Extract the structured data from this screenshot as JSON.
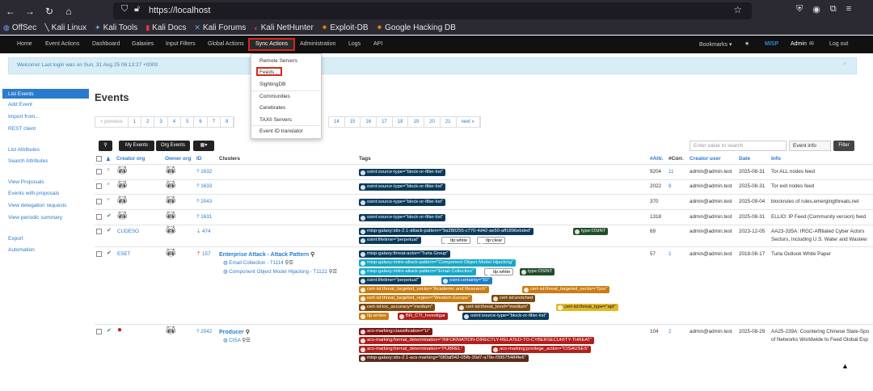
{
  "browser": {
    "url": "https://localhost",
    "bookmarks": [
      "OffSec",
      "Kali Linux",
      "Kali Tools",
      "Kali Docs",
      "Kali Forums",
      "Kali NetHunter",
      "Exploit-DB",
      "Google Hacking DB"
    ]
  },
  "topnav": {
    "items": [
      "Home",
      "Event Actions",
      "Dashboard",
      "Galaxies",
      "Input Filters",
      "Global Actions",
      "Sync Actions",
      "Administration",
      "Logs",
      "API"
    ],
    "right": [
      "Bookmarks ▾",
      "MISP",
      "Admin",
      "Log out"
    ]
  },
  "welcome": "Welcome! Last login was on Sun, 31 Aug 25 06:13:27 +0000",
  "sync_menu": [
    "Remote Servers",
    "Feeds",
    "SightingDB",
    "Communities",
    "Cerebrates",
    "TAXII Servers",
    "Event ID translator"
  ],
  "sidebar": {
    "group1": [
      "List Events",
      "Add Event",
      "Import from...",
      "REST client"
    ],
    "group2": [
      "List Attributes",
      "Search Attributes"
    ],
    "group3": [
      "View Proposals",
      "Events with proposals",
      "View delegation requests",
      "View periodic summary"
    ],
    "group4": [
      "Export",
      "Automation"
    ]
  },
  "page_title": "Events",
  "pagination": {
    "prev": "« previous",
    "pages_a": [
      "1",
      "2",
      "3",
      "4",
      "5",
      "6",
      "7",
      "8"
    ],
    "pages_b": [
      "14",
      "15",
      "16",
      "17",
      "18",
      "19",
      "20",
      "21"
    ],
    "next": "next »"
  },
  "toolbar": {
    "my_events": "My Events",
    "org_events": "Org Events",
    "search_placeholder": "Enter value to search",
    "filter_select": "Event info",
    "filter_button": "Filter"
  },
  "columns": [
    "Creator org",
    "Owner org",
    "ID",
    "Clusters",
    "Tags",
    "#Attr.",
    "#Corr.",
    "Creator user",
    "Date",
    "Info"
  ],
  "rows": [
    {
      "status": "×",
      "creator": "",
      "id": "1632",
      "attr": "9204",
      "corr": "11",
      "user": "admin@admin.test",
      "date": "2025-08-31",
      "info": "Tor ALL nodes feed",
      "tags": [
        "osint:source-type=\"block-or-filter-list\""
      ]
    },
    {
      "status": "×",
      "creator": "",
      "id": "1633",
      "attr": "2022",
      "corr": "8",
      "user": "admin@admin.test",
      "date": "2025-08-31",
      "info": "Tor exit nodes feed",
      "tags": [
        "osint:source-type=\"block-or-filter-list\""
      ]
    },
    {
      "status": "×",
      "creator": "",
      "id": "2043",
      "attr": "370",
      "corr": "",
      "user": "admin@admin.test",
      "date": "2025-09-04",
      "info": "blockrules of rules.emergingthreats.net",
      "tags": [
        "osint:source-type=\"block-or-filter-list\""
      ]
    },
    {
      "status": "✔",
      "creator": "",
      "id": "1631",
      "attr": "1318",
      "corr": "",
      "user": "admin@admin.test",
      "date": "2025-08-31",
      "info": "ELLIO: IP Feed (Community version) feed",
      "tags": [
        "osint:source-type=\"block-or-filter-list\""
      ]
    },
    {
      "status": "✔",
      "creator": "CUDESO",
      "id": "474",
      "attr": "69",
      "corr": "",
      "user": "admin@admin.test",
      "date": "2023-12-05",
      "info": "AA23-335A: IRGC-Affiliated Cyber Actors",
      "info2": "Sectors, Including U.S. Water and Wastew",
      "tags": [
        "misp-galaxy:stix-2.1-attack-pattern=\"9a280255-c770-4d42-ae50-aff1896ebded\"",
        "type:OSINT",
        "osint:lifetime=\"perpetual\"",
        "tlp:white",
        "tlp:clear"
      ]
    },
    {
      "status": "✔",
      "creator": "ESET",
      "id": "157",
      "attr": "57",
      "corr": "1",
      "user": "admin@admin.test",
      "date": "2018-08-17",
      "info": "Turla Outlook White Paper",
      "clusters": {
        "title": "Enterprise Attack - Attack Pattern",
        "items": [
          "Email Collection - T1114",
          "Component Object Model Hijacking - T1122"
        ]
      },
      "tags": [
        "misp-galaxy:threat-actor=\"Turla Group\"",
        "misp-galaxy:mitre-attack-pattern=\"Component Object Model Hijacking\"",
        "misp-galaxy:mitre-attack-pattern=\"Email Collection\"",
        "tlp:white",
        "type:OSINT",
        "osint:lifetime=\"perpetual\"",
        "osint:certainty=\"50\"",
        "cert-ist:threat_targeted_sector=\"Academic and Research\"",
        "cert-ist:threat_targeted_sector=\"Gov\"",
        "cert-ist:threat_targeted_region=\"Western Europe\"",
        "cert-ist:enriched",
        "cert-ist:ioc_accuracy=\"medium\"",
        "cert-ist:threat_level=\"medium\"",
        "cert-ist:threat_type=\"apt\"",
        "tlp:amber",
        "BR_CTI_Investigar",
        "osint:source-type=\"block-or-filter-list\""
      ]
    },
    {
      "status": "✔",
      "creator": "",
      "id": "2042",
      "attr": "104",
      "corr": "2",
      "user": "admin@admin.test",
      "date": "2025-08-29",
      "info": "AA25-239A: Countering Chinese State-Spo",
      "info2": "of Networks Worldwide to Feed Global Esp",
      "clusters": {
        "title": "Producer",
        "items": [
          "CISA"
        ]
      },
      "tags": [
        "acs-marking:classification=\"U\"",
        "acs-marking:formal_determination=\"INFORMATION-DIRECTLY-RELATED-TO-CYBERSECURITY-THREAT\"",
        "acs-marking:formal_determination=\"PUBREL\"",
        "acs-marking:privilege_action=\"CISAUSES\"",
        "misp-galaxy:stix-2.1-acs-marking=\"080af042-05fb-30d7-a79e-f39575484fe6\""
      ]
    }
  ]
}
